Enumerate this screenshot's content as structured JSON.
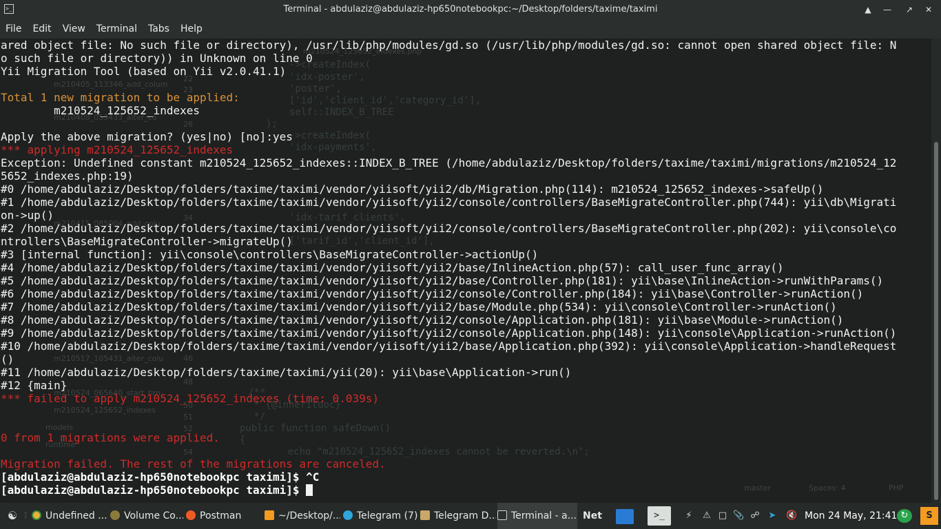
{
  "window": {
    "title": "Terminal - abdulaziz@abdulaziz-hp650notebookpc:~/Desktop/folders/taxime/taximi"
  },
  "menu": [
    "File",
    "Edit",
    "View",
    "Terminal",
    "Tabs",
    "Help"
  ],
  "terminal": {
    "lines": [
      {
        "cls": "c-white",
        "text": "ared object file: No such file or directory), /usr/lib/php/modules/gd.so (/usr/lib/php/modules/gd.so: cannot open shared object file: N"
      },
      {
        "cls": "c-white",
        "text": "o such file or directory)) in Unknown on line 0"
      },
      {
        "cls": "c-white",
        "text": "Yii Migration Tool (based on Yii v2.0.41.1)"
      },
      {
        "cls": "c-white",
        "text": ""
      },
      {
        "cls": "c-orange",
        "text": "Total 1 new migration to be applied:"
      },
      {
        "cls": "c-white",
        "text": "        m210524_125652_indexes"
      },
      {
        "cls": "c-white",
        "text": ""
      },
      {
        "cls": "c-white",
        "text": "Apply the above migration? (yes|no) [no]:yes"
      },
      {
        "cls": "c-red",
        "text": "*** applying m210524_125652_indexes"
      },
      {
        "cls": "c-white",
        "text": "Exception: Undefined constant m210524_125652_indexes::INDEX_B_TREE (/home/abdulaziz/Desktop/folders/taxime/taximi/migrations/m210524_12"
      },
      {
        "cls": "c-white",
        "text": "5652_indexes.php:19)"
      },
      {
        "cls": "c-white",
        "text": "#0 /home/abdulaziz/Desktop/folders/taxime/taximi/vendor/yiisoft/yii2/db/Migration.php(114): m210524_125652_indexes->safeUp()"
      },
      {
        "cls": "c-white",
        "text": "#1 /home/abdulaziz/Desktop/folders/taxime/taximi/vendor/yiisoft/yii2/console/controllers/BaseMigrateController.php(744): yii\\db\\Migrati"
      },
      {
        "cls": "c-white",
        "text": "on->up()"
      },
      {
        "cls": "c-white",
        "text": "#2 /home/abdulaziz/Desktop/folders/taxime/taximi/vendor/yiisoft/yii2/console/controllers/BaseMigrateController.php(202): yii\\console\\co"
      },
      {
        "cls": "c-white",
        "text": "ntrollers\\BaseMigrateController->migrateUp()"
      },
      {
        "cls": "c-white",
        "text": "#3 [internal function]: yii\\console\\controllers\\BaseMigrateController->actionUp()"
      },
      {
        "cls": "c-white",
        "text": "#4 /home/abdulaziz/Desktop/folders/taxime/taximi/vendor/yiisoft/yii2/base/InlineAction.php(57): call_user_func_array()"
      },
      {
        "cls": "c-white",
        "text": "#5 /home/abdulaziz/Desktop/folders/taxime/taximi/vendor/yiisoft/yii2/base/Controller.php(181): yii\\base\\InlineAction->runWithParams()"
      },
      {
        "cls": "c-white",
        "text": "#6 /home/abdulaziz/Desktop/folders/taxime/taximi/vendor/yiisoft/yii2/console/Controller.php(184): yii\\base\\Controller->runAction()"
      },
      {
        "cls": "c-white",
        "text": "#7 /home/abdulaziz/Desktop/folders/taxime/taximi/vendor/yiisoft/yii2/base/Module.php(534): yii\\console\\Controller->runAction()"
      },
      {
        "cls": "c-white",
        "text": "#8 /home/abdulaziz/Desktop/folders/taxime/taximi/vendor/yiisoft/yii2/console/Application.php(181): yii\\base\\Module->runAction()"
      },
      {
        "cls": "c-white",
        "text": "#9 /home/abdulaziz/Desktop/folders/taxime/taximi/vendor/yiisoft/yii2/console/Application.php(148): yii\\console\\Application->runAction()"
      },
      {
        "cls": "c-white",
        "text": "#10 /home/abdulaziz/Desktop/folders/taxime/taximi/vendor/yiisoft/yii2/base/Application.php(392): yii\\console\\Application->handleRequest"
      },
      {
        "cls": "c-white",
        "text": "()"
      },
      {
        "cls": "c-white",
        "text": "#11 /home/abdulaziz/Desktop/folders/taxime/taximi/yii(20): yii\\base\\Application->run()"
      },
      {
        "cls": "c-white",
        "text": "#12 {main}"
      },
      {
        "cls": "c-red",
        "text": "*** failed to apply m210524_125652_indexes (time: 0.039s)"
      },
      {
        "cls": "c-white",
        "text": ""
      },
      {
        "cls": "c-white",
        "text": ""
      },
      {
        "cls": "c-red",
        "text": "0 from 1 migrations were applied."
      },
      {
        "cls": "c-white",
        "text": ""
      },
      {
        "cls": "c-red",
        "text": "Migration failed. The rest of the migrations are canceled."
      }
    ],
    "prompt_user": "[abdulaziz@abdulaziz-hp650notebookpc",
    "prompt_dir": "taximi",
    "prompt_end": "]$",
    "prompt1_input": "^C",
    "prompt2_input": ""
  },
  "ghost_editor": {
    "code_lines": [
      "->createIndex(",
      "'idx-poster',",
      "'poster',",
      "['id','client_id','category_id'],",
      "self::INDEX_B_TREE",
      ");",
      "->createIndex(",
      "'idx-payments',",
      "'idx-tarif_clients',",
      "['tarif_id','client_id'],",
      "/**",
      " * {@inheritdoc}",
      " */",
      "public function safeDown()",
      "{",
      "    echo \"m210524_125652_indexes cannot be reverted.\\n\";"
    ],
    "line_numbers": [
      "22",
      "23",
      "26",
      "34",
      "46",
      "48",
      "50",
      "51",
      "52",
      "54"
    ],
    "files": [
      "m210405_113346_add_colum",
      "m210408_053433_alter_co",
      "m210415_085004_add_colu",
      "m210517_105431_alter_colu",
      "m210524_065640_start_tim",
      "m210524_125652_indexes",
      "models",
      "runtime"
    ],
    "tabs": [
      "m210524_125652_indexes.php"
    ],
    "status": [
      "master",
      "Spaces: 4",
      "PHP"
    ]
  },
  "taskbar": {
    "tasks": [
      {
        "label": "Undefined ...",
        "icon": "chrome-icon",
        "color": "#e8b23a"
      },
      {
        "label": "Volume Co...",
        "icon": "volume-app-icon",
        "color": "#8a7b3a"
      },
      {
        "label": "Postman",
        "icon": "postman-icon",
        "color": "#ef5b25"
      },
      {
        "label": "~/Desktop/...",
        "icon": "sublime-icon",
        "color": "#f49b21"
      },
      {
        "label": "Telegram (7)",
        "icon": "telegram-icon",
        "color": "#2ea6de"
      },
      {
        "label": "Telegram D...",
        "icon": "folder-icon",
        "color": "#c9a86a"
      },
      {
        "label": "Terminal - a...",
        "icon": "terminal-icon",
        "color": "#cfd4d1"
      }
    ],
    "net_label": "Net",
    "clock": "Mon 24 May, 21:41"
  }
}
